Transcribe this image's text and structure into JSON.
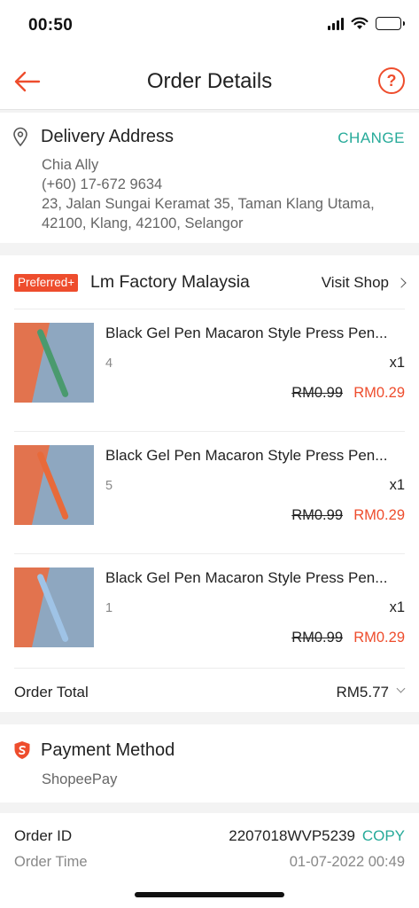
{
  "status_bar": {
    "time": "00:50",
    "icons": [
      "signal-icon",
      "wifi-icon",
      "battery-icon"
    ]
  },
  "header": {
    "title": "Order Details",
    "back_icon": "arrow-left-icon",
    "help_icon": "question-circle-icon",
    "help_symbol": "?"
  },
  "delivery": {
    "title": "Delivery Address",
    "change_label": "CHANGE",
    "name": "Chia Ally",
    "phone": "(+60) 17-672 9634",
    "address_line1": "23, Jalan Sungai Keramat 35, Taman Klang Utama,",
    "address_line2": "42100, Klang, 42100, Selangor"
  },
  "shop": {
    "badge": "Preferred+",
    "name": "Lm Factory Malaysia",
    "visit_label": "Visit Shop",
    "items": [
      {
        "title": "Black Gel Pen Macaron Style Press Pen...",
        "variant": "4",
        "qty": "x1",
        "price_old": "RM0.99",
        "price_new": "RM0.29",
        "pen_color": "#4a9a6e",
        "bg_color": "#e2734e"
      },
      {
        "title": "Black Gel Pen Macaron Style Press Pen...",
        "variant": "5",
        "qty": "x1",
        "price_old": "RM0.99",
        "price_new": "RM0.29",
        "pen_color": "#e86a3a",
        "bg_color": "#e2734e"
      },
      {
        "title": "Black Gel Pen Macaron Style Press Pen...",
        "variant": "1",
        "qty": "x1",
        "price_old": "RM0.99",
        "price_new": "RM0.29",
        "pen_color": "#9fc3e6",
        "bg_color": "#e2734e"
      }
    ],
    "total_label": "Order Total",
    "total_value": "RM5.77"
  },
  "payment": {
    "title": "Payment Method",
    "value": "ShopeePay"
  },
  "order": {
    "id_label": "Order ID",
    "id_value": "2207018WVP5239",
    "copy_label": "COPY",
    "time_label": "Order Time",
    "time_value": "01-07-2022 00:49"
  },
  "colors": {
    "accent": "#ee4d2d",
    "teal": "#26aa99"
  }
}
